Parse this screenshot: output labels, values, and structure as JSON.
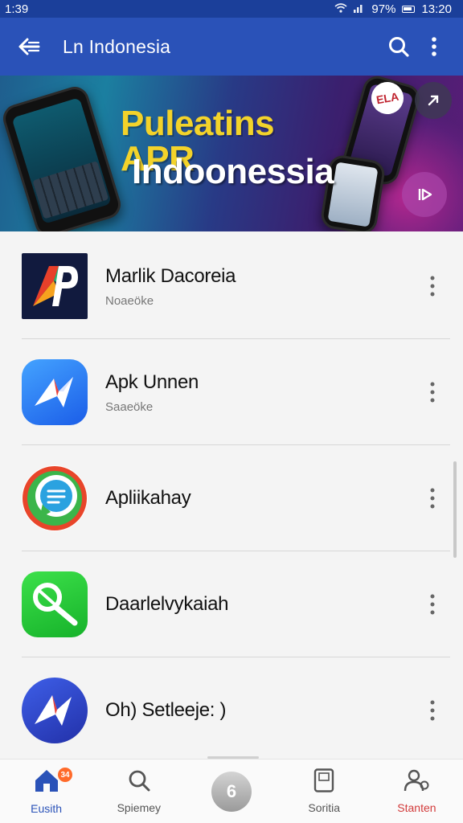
{
  "status_bar": {
    "time": "1:39",
    "battery": "97%",
    "clock": "13:20"
  },
  "app_bar": {
    "title": "Ln Indonesia"
  },
  "banner": {
    "line1": "Puleatins APR",
    "line2": "Indoonessia",
    "disc_label": "ELA"
  },
  "apps": [
    {
      "name": "Marlik Dacoreia",
      "subtitle": "Noaeöke",
      "icon": "ap-logo"
    },
    {
      "name": "Apk Unnen",
      "subtitle": "Saaeöke",
      "icon": "arrow-plane-logo"
    },
    {
      "name": "Apliikahay",
      "subtitle": "",
      "icon": "chat-bubble-logo"
    },
    {
      "name": "Daarlelvykaiah",
      "subtitle": "",
      "icon": "key-search-logo"
    },
    {
      "name": "Oh) Setleeje: )",
      "subtitle": "",
      "icon": "arrow-logo"
    }
  ],
  "bottom_nav": {
    "items": [
      {
        "label": "Eusith",
        "icon": "home-icon",
        "badge": "34"
      },
      {
        "label": "Spiemey",
        "icon": "search-icon"
      },
      {
        "label": "",
        "icon": "center-action",
        "center_glyph": "6"
      },
      {
        "label": "Soritia",
        "icon": "tablet-icon"
      },
      {
        "label": "Stanten",
        "icon": "profile-icon"
      }
    ]
  },
  "colors": {
    "status_bar": "#1b3f9a",
    "app_bar": "#2a52b8",
    "banner_yellow": "#f3d32a",
    "active_nav": "#2a52b8",
    "alert_nav": "#d23a3a"
  }
}
